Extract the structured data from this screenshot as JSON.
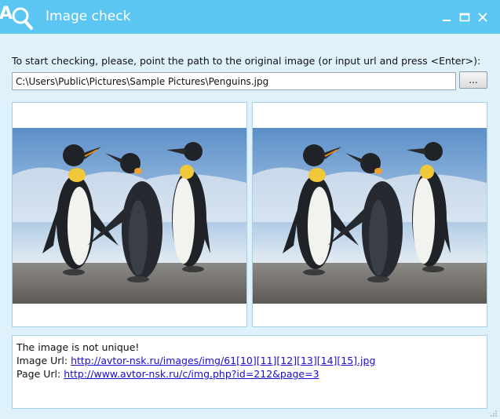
{
  "window": {
    "title": "Image check",
    "buttons": {
      "minimize": "minimize-icon",
      "maximize": "maximize-icon",
      "close": "close-icon"
    }
  },
  "instruction_text": "To start checking, please, point the path to the original image (or input url and press <Enter>):",
  "path_input": {
    "value": "C:\\Users\\Public\\Pictures\\Sample Pictures\\Penguins.jpg"
  },
  "browse_button": {
    "label": "..."
  },
  "images": [
    {
      "name": "original-image",
      "depicts": "Penguins"
    },
    {
      "name": "found-image",
      "depicts": "Penguins"
    }
  ],
  "result": {
    "status": "The image is not unique!",
    "image_url_label": "Image Url: ",
    "image_url": "http://avtor-nsk.ru/images/img/61[10][11][12][13][14][15].jpg",
    "page_url_label": "Page Url: ",
    "page_url": "http://www.avtor-nsk.ru/c/img.php?id=212&page=3"
  },
  "colors": {
    "titlebar": "#5cc6f2",
    "window_bg": "#dff1fb",
    "link": "#1a0dcc",
    "panel_border": "#a6cfe3"
  }
}
